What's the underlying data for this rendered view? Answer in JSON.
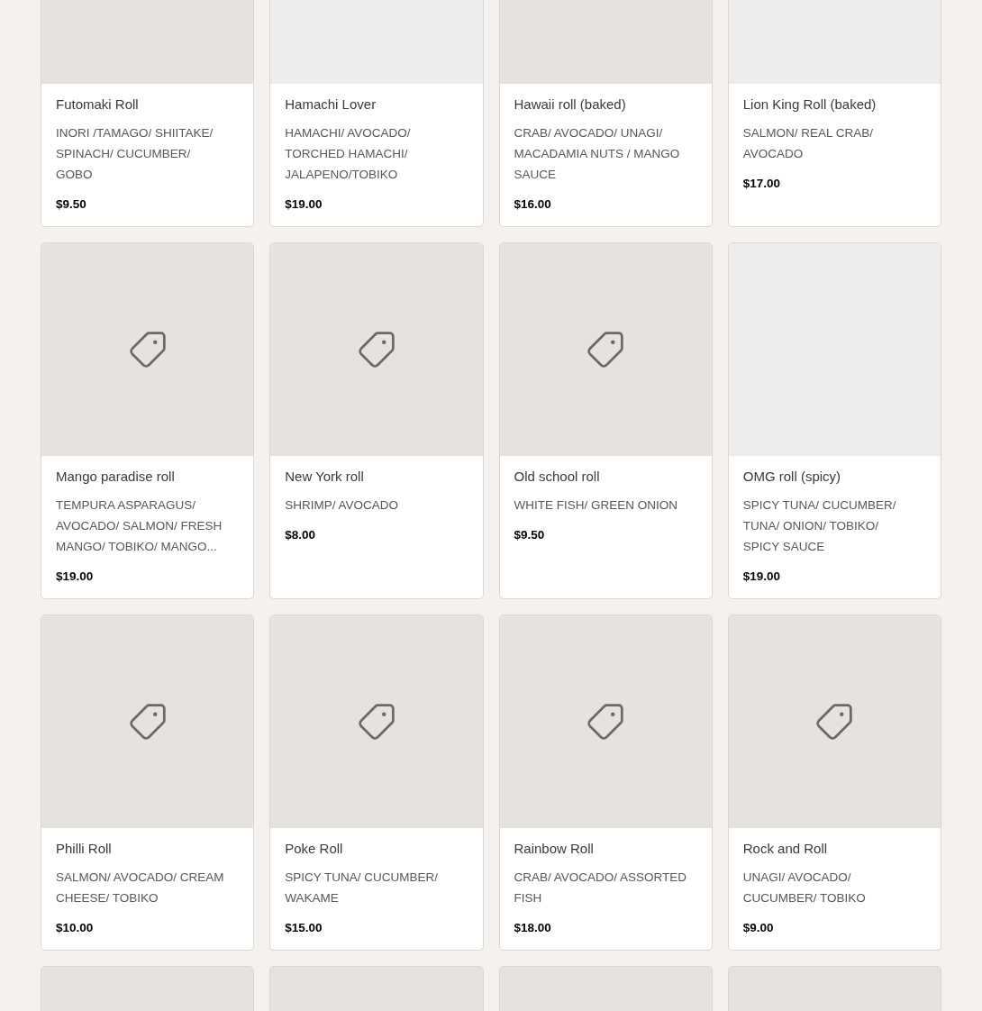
{
  "cards": [
    {
      "kind": "plain",
      "title": "Futomaki Roll",
      "description": "INORI /TAMAGO/ SHIITAKE/ SPINACH/ CUCUMBER/ GOBO",
      "price": "$9.50"
    },
    {
      "kind": "blank",
      "title": "Hamachi Lover",
      "description": "HAMACHI/ AVOCADO/ TORCHED HAMACHI/ JALAPENO/TOBIKO",
      "price": "$19.00"
    },
    {
      "kind": "plain",
      "title": "Hawaii roll (baked)",
      "description": "CRAB/ AVOCADO/ UNAGI/ MACADAMIA NUTS / MANGO SAUCE",
      "price": "$16.00"
    },
    {
      "kind": "blank",
      "title": "Lion King Roll (baked)",
      "description": "SALMON/ REAL CRAB/ AVOCADO",
      "price": "$17.00"
    },
    {
      "kind": "placeholder",
      "title": "Mango paradise roll",
      "description": "TEMPURA ASPARAGUS/ AVOCADO/ SALMON/ FRESH MANGO/ TOBIKO/ MANGO...",
      "price": "$19.00"
    },
    {
      "kind": "placeholder",
      "title": "New York roll",
      "description": "SHRIMP/ AVOCADO",
      "price": "$8.00"
    },
    {
      "kind": "placeholder",
      "title": "Old school roll",
      "description": "WHITE FISH/ GREEN ONION",
      "price": "$9.50"
    },
    {
      "kind": "blank",
      "title": "OMG roll (spicy)",
      "description": "SPICY TUNA/ CUCUMBER/ TUNA/ ONION/ TOBIKO/ SPICY SAUCE",
      "price": "$19.00"
    },
    {
      "kind": "placeholder",
      "title": "Philli Roll",
      "description": "SALMON/ AVOCADO/ CREAM CHEESE/ TOBIKO",
      "price": "$10.00"
    },
    {
      "kind": "placeholder",
      "title": "Poke Roll",
      "description": "SPICY TUNA/ CUCUMBER/ WAKAME",
      "price": "$15.00"
    },
    {
      "kind": "placeholder",
      "title": "Rainbow Roll",
      "description": "CRAB/ AVOCADO/ ASSORTED FISH",
      "price": "$18.00"
    },
    {
      "kind": "placeholder",
      "title": "Rock and Roll",
      "description": "UNAGI/ AVOCADO/ CUCUMBER/ TOBIKO",
      "price": "$9.00"
    },
    {
      "kind": "plain"
    },
    {
      "kind": "plain"
    },
    {
      "kind": "plain"
    },
    {
      "kind": "plain"
    }
  ]
}
